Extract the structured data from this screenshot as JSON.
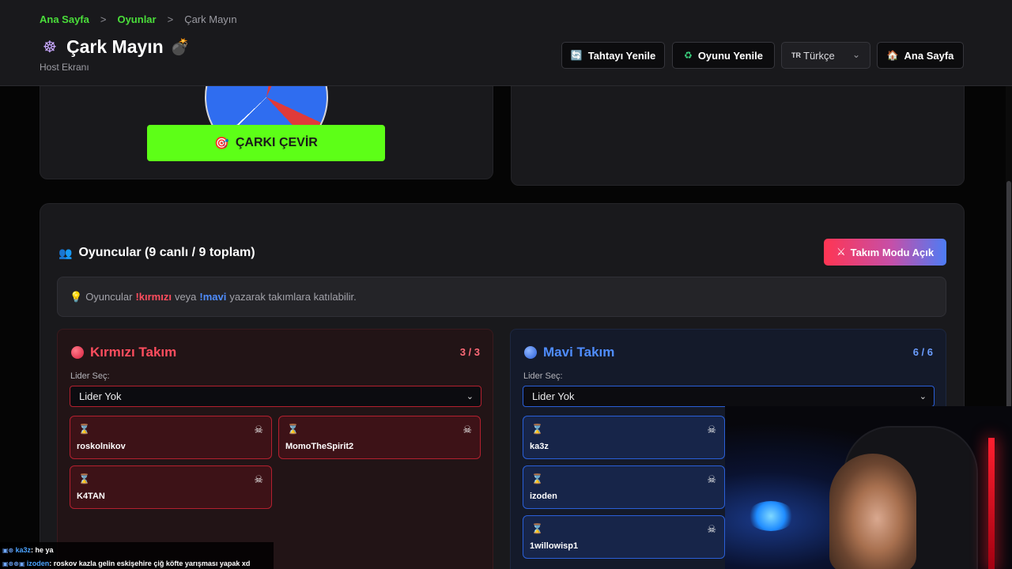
{
  "breadcrumb": {
    "home": "Ana Sayfa",
    "games": "Oyunlar",
    "current": "Çark Mayın",
    "sep": ">"
  },
  "header": {
    "title_emoji": "☸",
    "title": "Çark Mayın",
    "title_suffix_emoji": "💣",
    "subtitle": "Host Ekranı",
    "buttons": {
      "refresh_board": "Tahtayı Yenile",
      "restart_game": "Oyunu Yenile",
      "home": "Ana Sayfa"
    },
    "language": {
      "flag": "TR",
      "label": "Türkçe"
    }
  },
  "wheel": {
    "spin_label": "ÇARKI ÇEVİR"
  },
  "players": {
    "title": "Oyuncular (9 canlı / 9 toplam)",
    "team_mode_label": "Takım Modu Açık",
    "hint": {
      "prefix": "Oyuncular",
      "red_cmd": "!kırmızı",
      "mid": "veya",
      "blue_cmd": "!mavi",
      "suffix": "yazarak takımlara katılabilir."
    }
  },
  "teams": {
    "red": {
      "name": "Kırmızı Takım",
      "count": "3 / 3",
      "leader_label": "Lider Seç:",
      "leader_value": "Lider Yok",
      "members": [
        "roskolnikov",
        "MomoTheSpirit2",
        "K4TAN"
      ]
    },
    "blue": {
      "name": "Mavi Takım",
      "count": "6 / 6",
      "leader_label": "Lider Seç:",
      "leader_value": "Lider Yok",
      "members": [
        "ka3z",
        "izoden",
        "1willowisp1"
      ]
    }
  },
  "chat": [
    {
      "user": "ka3z",
      "text": ": he ya"
    },
    {
      "user": "izoden",
      "text": ": roskov kazla gelin eskişehire çiğ köfte yarışması yapak xd"
    }
  ],
  "colors": {
    "accent_green": "#5dff17",
    "red": "#ff4d5e",
    "blue": "#4f8dff"
  }
}
